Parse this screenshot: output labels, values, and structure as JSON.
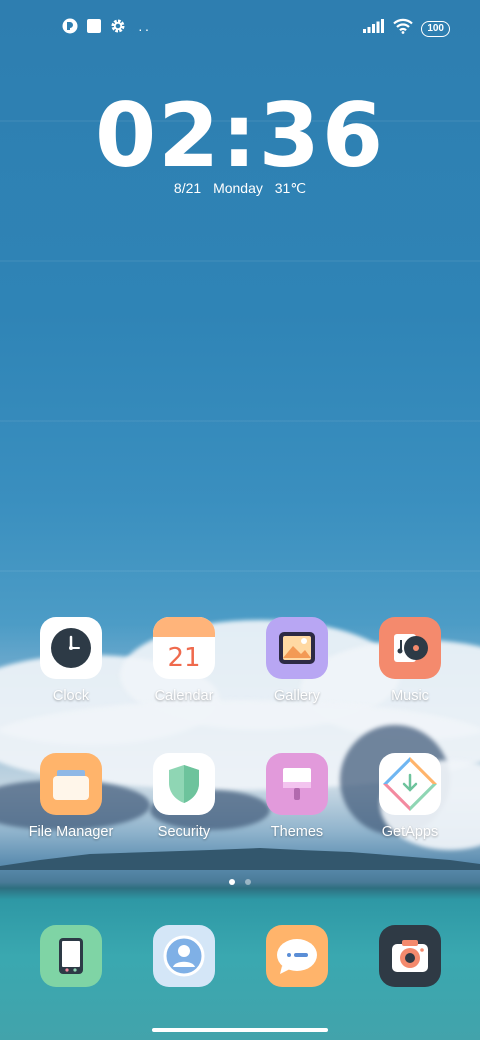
{
  "status_bar": {
    "left_icons": [
      "notification-app-icon",
      "square-notification-icon",
      "gear-icon"
    ],
    "more_dots": "··",
    "signal_icon": "cellular-signal-icon",
    "wifi_icon": "wifi-icon",
    "battery_level": "100"
  },
  "lock_clock": {
    "time": "02:36",
    "date": "8/21",
    "weekday": "Monday",
    "temperature": "31℃"
  },
  "home_apps": [
    {
      "label": "Clock",
      "icon": "clock-icon",
      "color": "#ffffff"
    },
    {
      "label": "Calendar",
      "icon": "calendar-icon",
      "color": "#ffffff",
      "day": "21"
    },
    {
      "label": "Gallery",
      "icon": "gallery-icon",
      "color": "#b8a6f3"
    },
    {
      "label": "Music",
      "icon": "music-icon",
      "color": "#f48a6d"
    },
    {
      "label": "File Manager",
      "icon": "folder-icon",
      "color": "#ffb46b"
    },
    {
      "label": "Security",
      "icon": "shield-icon",
      "color": "#ffffff"
    },
    {
      "label": "Themes",
      "icon": "paintbrush-icon",
      "color": "#e29adb"
    },
    {
      "label": "GetApps",
      "icon": "getapps-icon",
      "color": "#ffffff"
    }
  ],
  "page_indicator": {
    "pages": 2,
    "active": 1
  },
  "dock": [
    {
      "icon": "phone-icon",
      "color": "#7fd4a5"
    },
    {
      "icon": "contacts-icon",
      "color": "#d4e6f7"
    },
    {
      "icon": "messages-icon",
      "color": "#ffb46b"
    },
    {
      "icon": "camera-icon",
      "color": "#2f3a45"
    }
  ]
}
